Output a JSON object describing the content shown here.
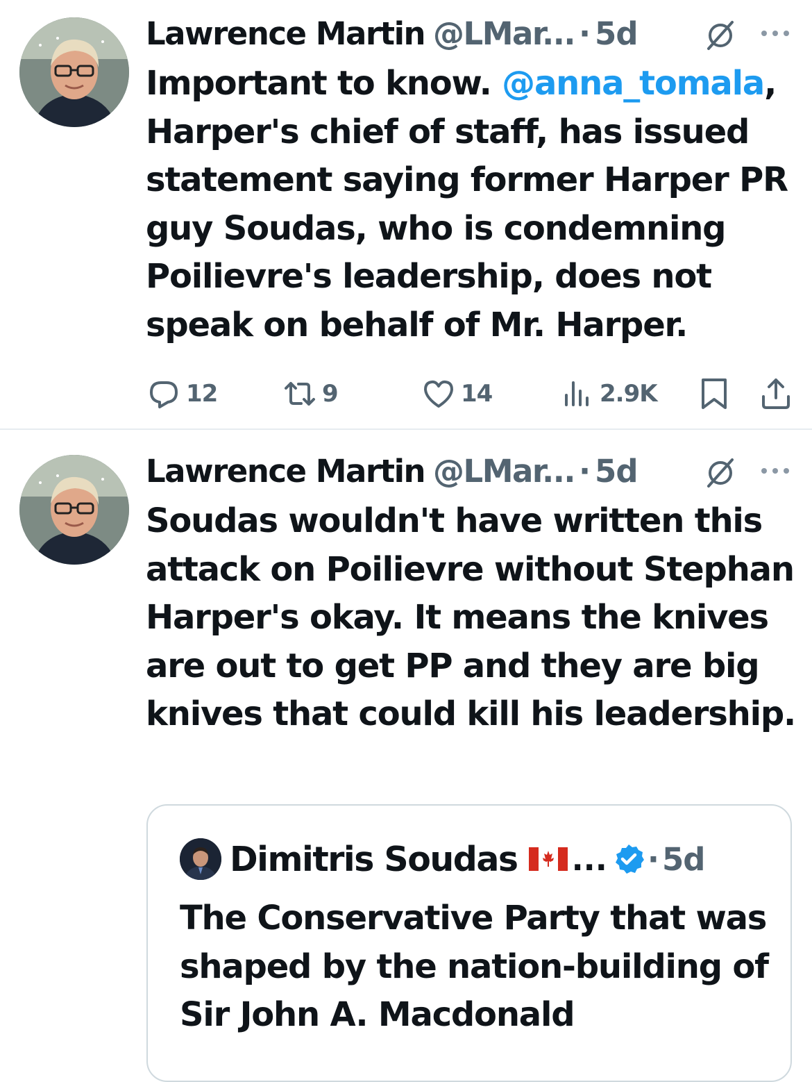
{
  "tweets": [
    {
      "author_name": "Lawrence Martin",
      "author_handle": "@LMar...",
      "separator": "·",
      "time": "5d",
      "text_segments": [
        "Important to know. ",
        "@anna_tomala",
        ", Harper's chief of staff, has issued statement saying former Harper PR guy Soudas, who is condemning Poilievre's leadership, does not speak on behalf of Mr. Harper."
      ],
      "actions": {
        "replies": "12",
        "reposts": "9",
        "likes": "14",
        "views": "2.9K"
      }
    },
    {
      "author_name": "Lawrence Martin",
      "author_handle": "@LMar...",
      "separator": "·",
      "time": "5d",
      "text": "Soudas wouldn't have written this attack on Poilievre without Stephan Harper's okay. It means the knives are out to get PP and they are big knives that could kill his leadership.",
      "quoted": {
        "author_name": "Dimitris Soudas",
        "ellipsis": "...",
        "separator": "·",
        "time": "5d",
        "text": "The Conservative Party that was shaped by the nation-building of Sir John A. Macdonald"
      }
    }
  ],
  "colors": {
    "text": "#0f1419",
    "secondary": "#536471",
    "link": "#1d9bf0",
    "border": "#cfd9de"
  },
  "icons": [
    "grok-icon",
    "more-icon",
    "reply-icon",
    "repost-icon",
    "like-icon",
    "views-icon",
    "bookmark-icon",
    "share-icon",
    "verified-icon",
    "canada-flag-icon"
  ]
}
